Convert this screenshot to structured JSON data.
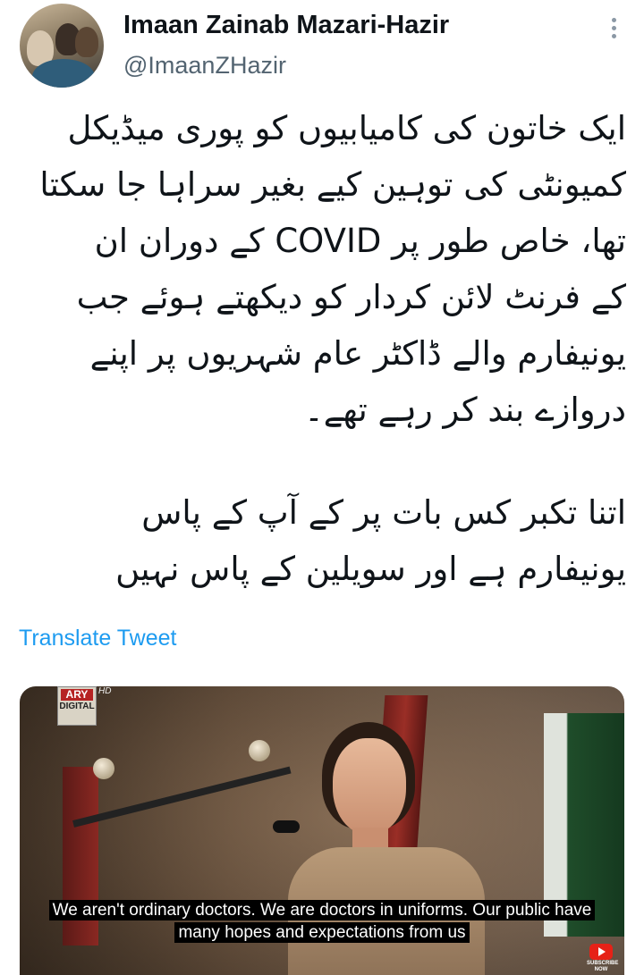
{
  "author": {
    "name": "Imaan Zainab Mazari-Hazir",
    "handle": "@ImaanZHazir"
  },
  "tweet": {
    "paragraph1": [
      "ایک خاتون کی کامیابیوں کو پوری میڈیکل",
      "کمیونٹی کی توہین کیے بغیر سراہا جا سکتا",
      "تھا، خاص طور پر COVID کے دوران ان",
      "کے فرنٹ لائن کردار کو دیکھتے ہوئے جب",
      "یونیفارم والے ڈاکٹر عام شہریوں پر اپنے",
      "دروازے بند کر رہے تھے۔"
    ],
    "paragraph2": [
      "اتنا تکبر کس بات پر کے آپ کے پاس",
      "یونیفارم ہے اور سویلین کے پاس نہیں"
    ],
    "translate_label": "Translate Tweet"
  },
  "media": {
    "channel_logo": "ARY",
    "channel_logo_sub": "DIGITAL",
    "hd_label": "HD",
    "subtitle_line1": "We aren't ordinary doctors. We are doctors in uniforms. Our public have",
    "subtitle_line2": "many hopes and expectations from us",
    "subscribe_label": "SUBSCRIBE NOW"
  },
  "icons": {
    "more": "more-vertical-icon",
    "youtube": "youtube-icon"
  },
  "colors": {
    "link": "#1d9bf0",
    "text": "#0f1419",
    "secondary": "#536471"
  }
}
